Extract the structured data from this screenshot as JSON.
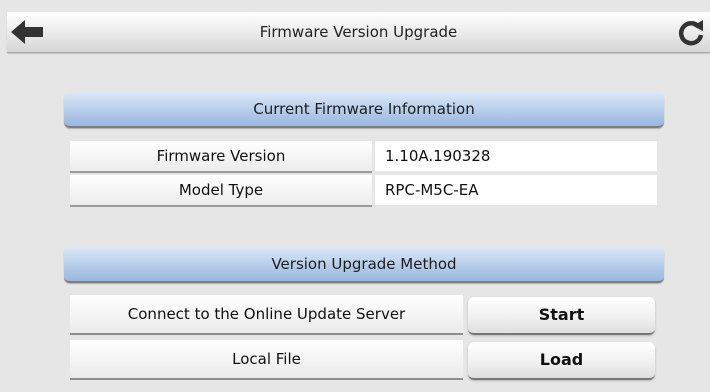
{
  "header": {
    "title": "Firmware Version Upgrade",
    "back_icon": "arrow-left-icon",
    "reload_icon": "refresh-icon"
  },
  "current_firmware": {
    "heading": "Current Firmware Information",
    "rows": [
      {
        "label": "Firmware Version",
        "value": "1.10A.190328"
      },
      {
        "label": "Model Type",
        "value": "RPC-M5C-EA"
      }
    ]
  },
  "upgrade_method": {
    "heading": "Version Upgrade Method",
    "rows": [
      {
        "label": "Connect to the Online Update Server",
        "button": "Start"
      },
      {
        "label": "Local File",
        "button": "Load"
      }
    ]
  },
  "colors": {
    "section_header": "#b6cdea",
    "background": "#e6e6e6"
  }
}
